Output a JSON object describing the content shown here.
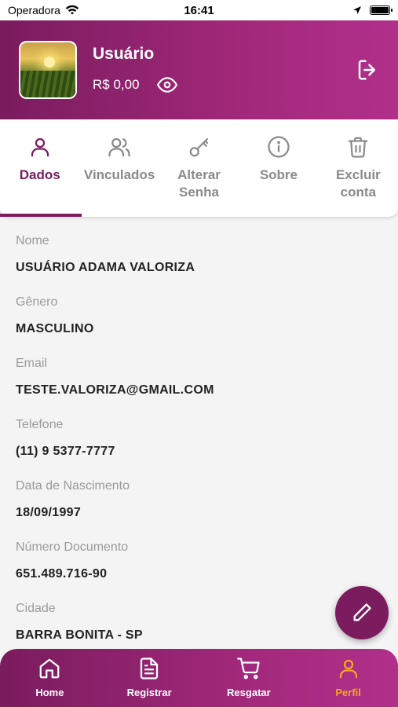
{
  "status_bar": {
    "carrier": "Operadora",
    "time": "16:41"
  },
  "header": {
    "user_name": "Usuário",
    "balance": "R$ 0,00"
  },
  "tabs": [
    {
      "label": "Dados",
      "icon": "user-icon",
      "active": true
    },
    {
      "label": "Vinculados",
      "icon": "users-icon",
      "active": false
    },
    {
      "label": "Alterar Senha",
      "icon": "key-icon",
      "active": false
    },
    {
      "label": "Sobre",
      "icon": "info-icon",
      "active": false
    },
    {
      "label": "Excluir conta",
      "icon": "trash-icon",
      "active": false
    }
  ],
  "fields": [
    {
      "label": "Nome",
      "value": "USUÁRIO ADAMA VALORIZA"
    },
    {
      "label": "Gênero",
      "value": "MASCULINO"
    },
    {
      "label": "Email",
      "value": "TESTE.VALORIZA@GMAIL.COM"
    },
    {
      "label": "Telefone",
      "value": "(11) 9 5377-7777"
    },
    {
      "label": "Data de Nascimento",
      "value": "18/09/1997"
    },
    {
      "label": "Número Documento",
      "value": "651.489.716-90"
    },
    {
      "label": "Cidade",
      "value": "BARRA BONITA - SP"
    }
  ],
  "bottom_nav": [
    {
      "label": "Home",
      "icon": "home-icon",
      "active": false
    },
    {
      "label": "Registrar",
      "icon": "document-icon",
      "active": false
    },
    {
      "label": "Resgatar",
      "icon": "cart-icon",
      "active": false
    },
    {
      "label": "Perfil",
      "icon": "user-icon",
      "active": true
    }
  ],
  "colors": {
    "primary": "#7a1c5e",
    "accent": "#f5a623"
  }
}
